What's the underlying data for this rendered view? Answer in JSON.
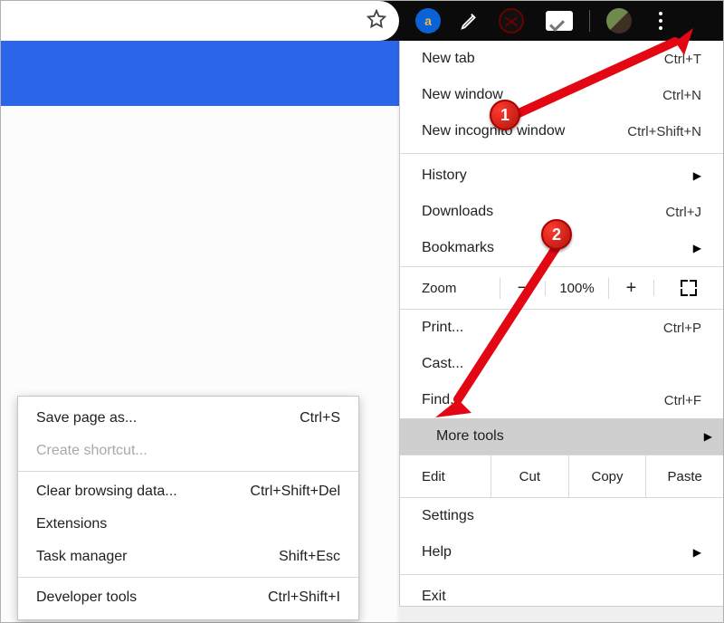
{
  "toolbar": {
    "star_title": "Bookmark this page",
    "amazon_glyph": "a"
  },
  "menu": {
    "new_tab": "New tab",
    "new_tab_sc": "Ctrl+T",
    "new_window": "New window",
    "new_window_sc": "Ctrl+N",
    "incognito": "New incognito window",
    "incognito_sc": "Ctrl+Shift+N",
    "history": "History",
    "downloads": "Downloads",
    "downloads_sc": "Ctrl+J",
    "bookmarks": "Bookmarks",
    "zoom_label": "Zoom",
    "zoom_minus": "−",
    "zoom_value": "100%",
    "zoom_plus": "+",
    "print": "Print...",
    "print_sc": "Ctrl+P",
    "cast": "Cast...",
    "find": "Find...",
    "find_sc": "Ctrl+F",
    "more_tools": "More tools",
    "edit_label": "Edit",
    "cut": "Cut",
    "copy": "Copy",
    "paste": "Paste",
    "settings": "Settings",
    "help": "Help",
    "exit": "Exit"
  },
  "submenu": {
    "save_as": "Save page as...",
    "save_as_sc": "Ctrl+S",
    "create_shortcut": "Create shortcut...",
    "clear_data": "Clear browsing data...",
    "clear_data_sc": "Ctrl+Shift+Del",
    "extensions": "Extensions",
    "task_manager": "Task manager",
    "task_manager_sc": "Shift+Esc",
    "dev_tools": "Developer tools",
    "dev_tools_sc": "Ctrl+Shift+I"
  },
  "annotations": {
    "one": "1",
    "two": "2"
  }
}
